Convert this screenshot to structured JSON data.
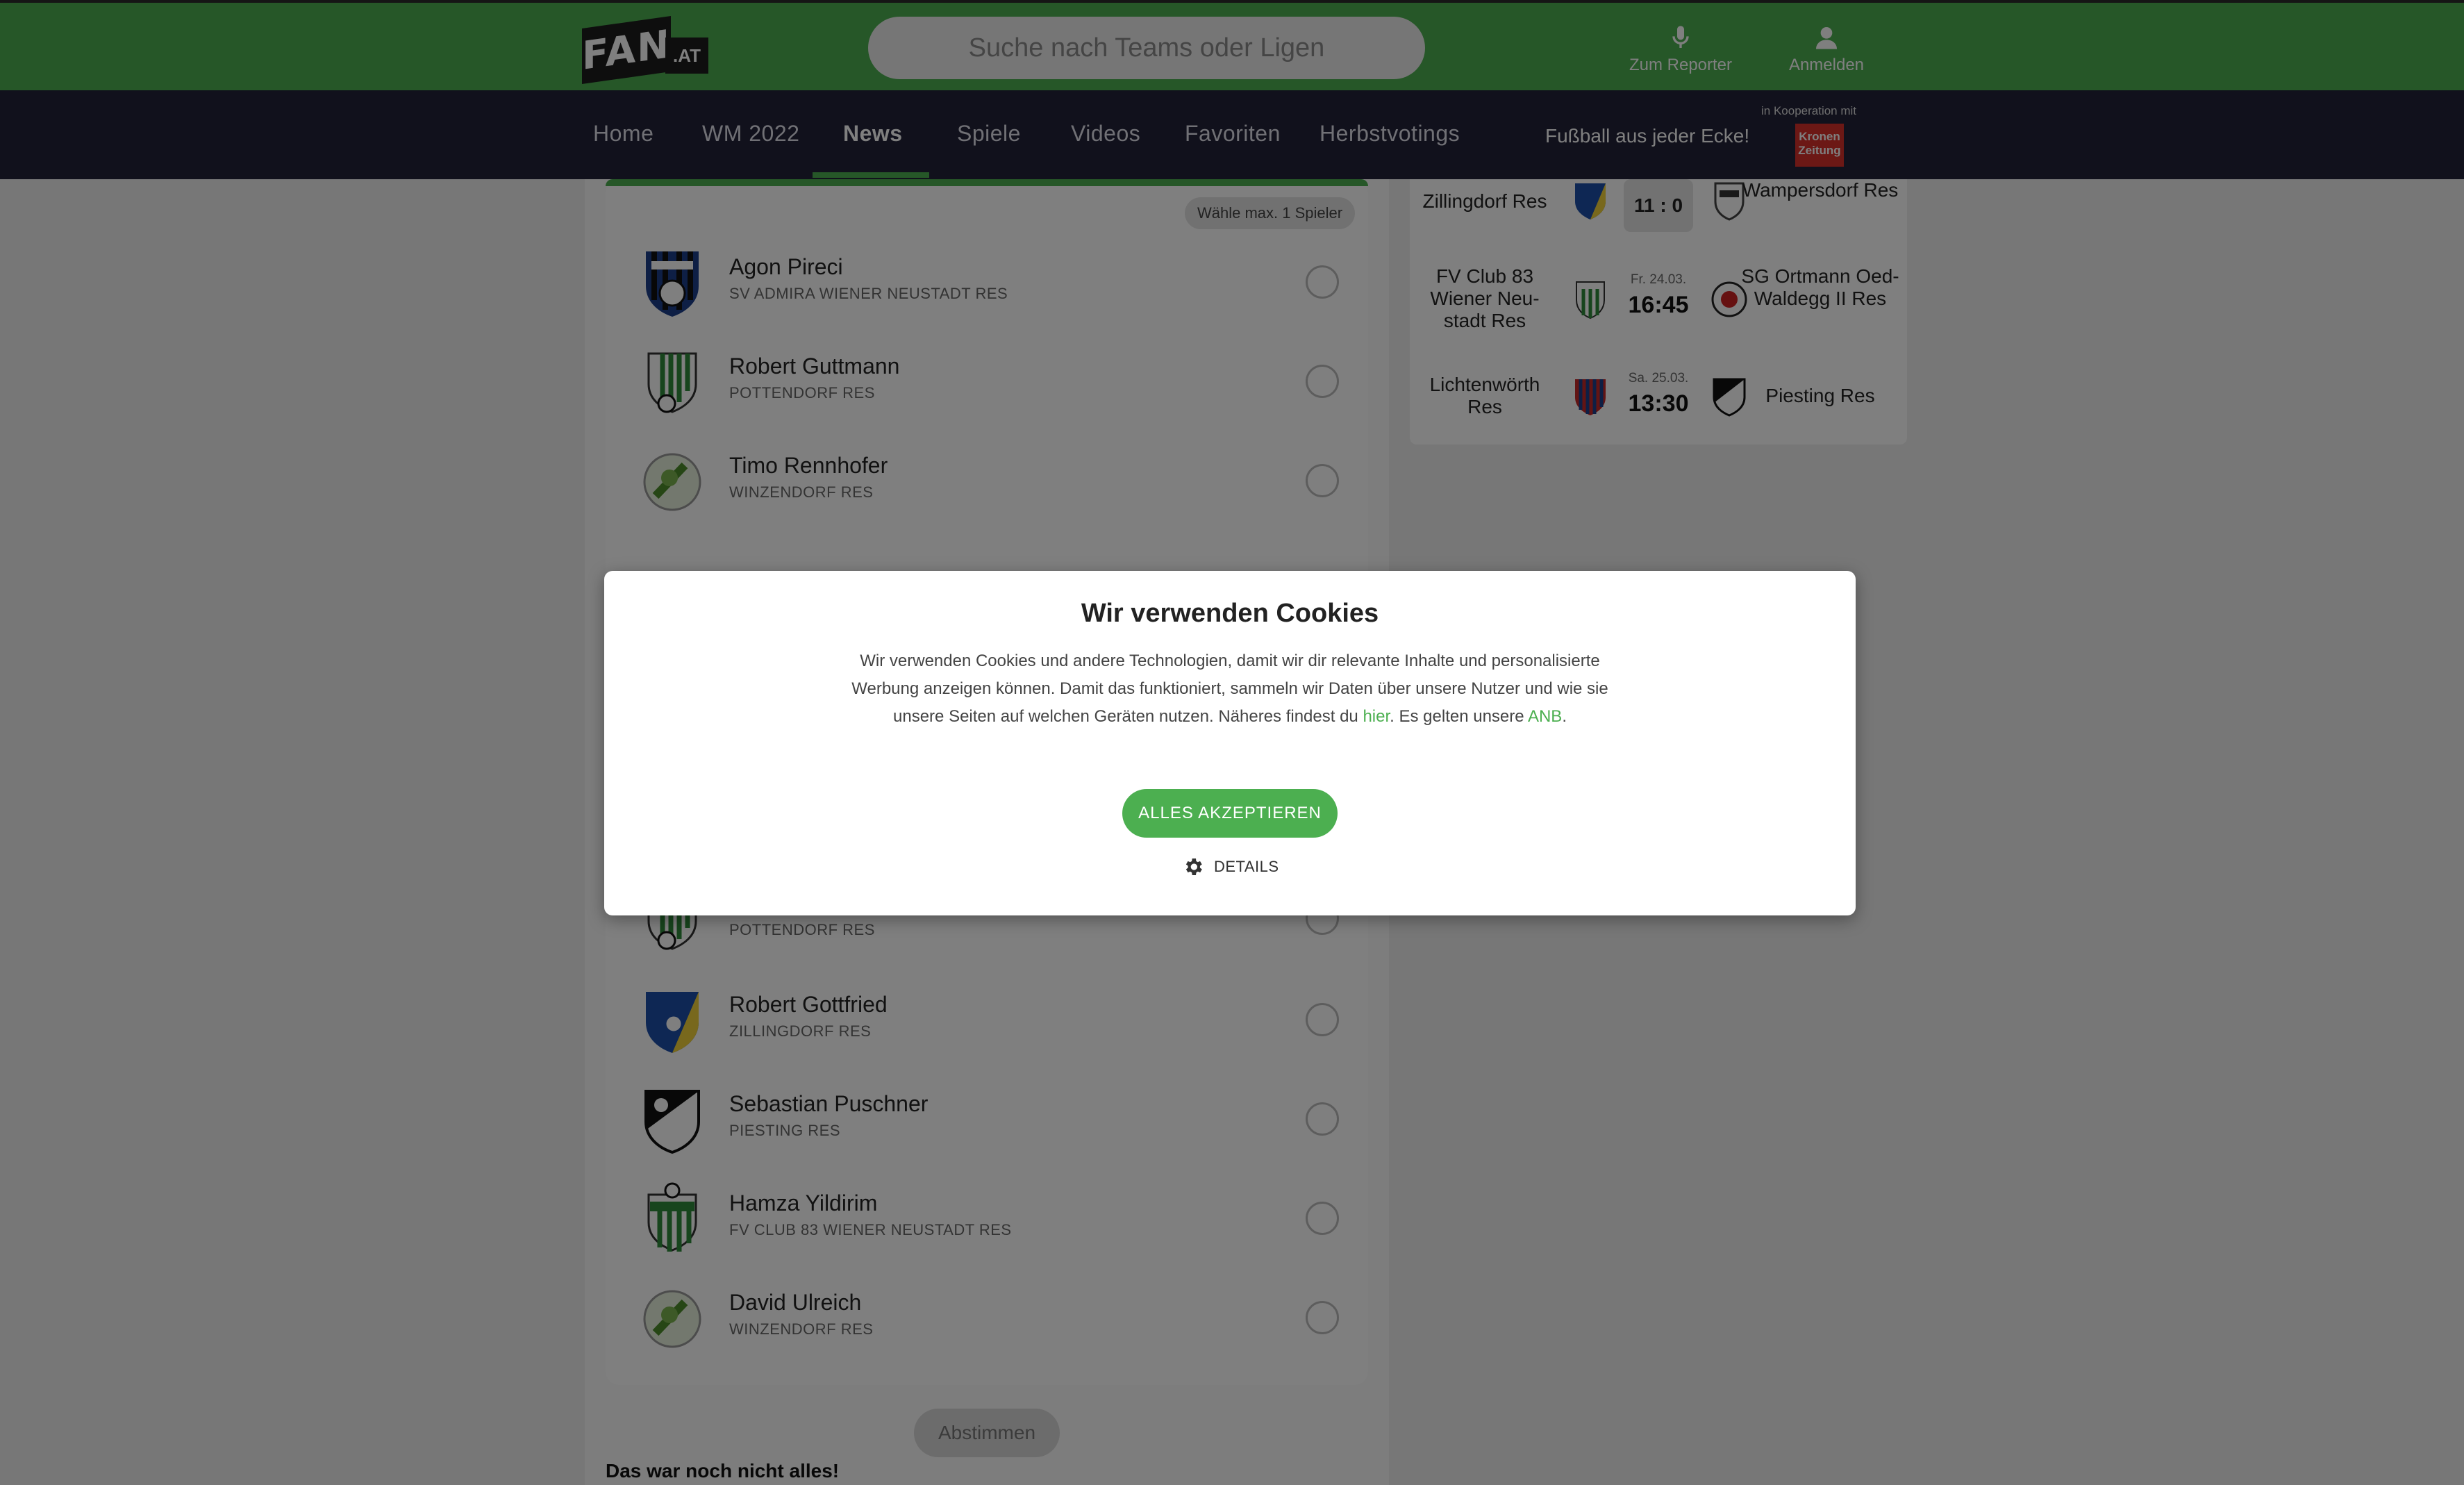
{
  "header": {
    "logo_main": "FAN",
    "logo_sub": ".AT",
    "search_placeholder": "Suche nach Teams oder Ligen",
    "reporter_label": "Zum Reporter",
    "login_label": "Anmelden",
    "colors": {
      "brand_green": "#4caf50",
      "nav_bg": "#222238"
    }
  },
  "nav": {
    "items": [
      "Home",
      "WM 2022",
      "News",
      "Spiele",
      "Videos",
      "Favoriten",
      "Herbstvotings"
    ],
    "active": "News",
    "slogan": "Fußball aus jeder Ecke!",
    "coop_label": "in Kooperation mit",
    "partner_line1": "Kronen",
    "partner_line2": "Zeitung"
  },
  "voting": {
    "max_badge": "Wähle max. 1 Spieler",
    "players": [
      {
        "name": "Agon Pireci",
        "team": "SV ADMIRA WIENER NEUSTADT RES"
      },
      {
        "name": "Robert Guttmann",
        "team": "POTTENDORF RES"
      },
      {
        "name": "Timo Rennhofer",
        "team": "WINZENDORF RES"
      },
      {
        "name": "",
        "team": "POTTENDORF RES"
      },
      {
        "name": "Robert Gottfried",
        "team": "ZILLINGDORF RES"
      },
      {
        "name": "Sebastian Puschner",
        "team": "PIESTING RES"
      },
      {
        "name": "Hamza Yildirim",
        "team": "FV CLUB 83 WIENER NEUSTADT RES"
      },
      {
        "name": "David Ulreich",
        "team": "WINZENDORF RES"
      }
    ],
    "submit_label": "Abstimmen",
    "more_label": "Das war noch nicht alles!"
  },
  "matches": [
    {
      "home": "Zillingdorf Res",
      "away": "Wampersdorf Res",
      "score": "11 : 0"
    },
    {
      "home": "FV Club 83 Wiener Neu-stadt Res",
      "away": "SG Ortmann Oed-Waldegg II Res",
      "date": "Fr. 24.03.",
      "time": "16:45"
    },
    {
      "home": "Lichtenwörth Res",
      "away": "Piesting Res",
      "date": "Sa. 25.03.",
      "time": "13:30"
    }
  ],
  "cookie": {
    "title": "Wir verwenden Cookies",
    "text_before": "Wir verwenden Cookies und andere Technologien, damit wir dir relevante Inhalte und personalisierte Werbung anzeigen können. Damit das funktioniert, sammeln wir Daten über unsere Nutzer und wie sie unsere Seiten auf welchen Geräten nutzen. Näheres findest du ",
    "link_here": "hier",
    "text_middle": ". Es gelten unsere ",
    "link_anb": "ANB",
    "text_after": ".",
    "accept_label": "ALLES AKZEPTIEREN",
    "details_label": "DETAILS"
  }
}
